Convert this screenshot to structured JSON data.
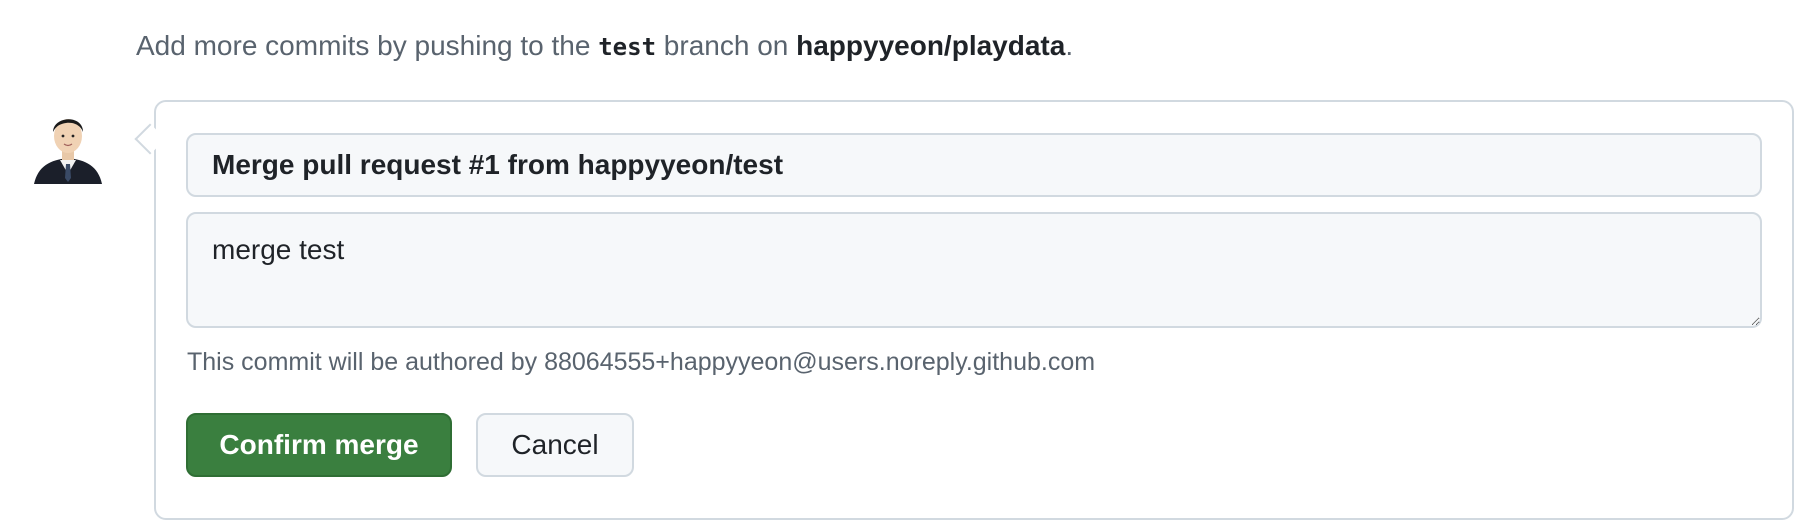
{
  "hint": {
    "prefix": "Add more commits by pushing to the ",
    "branch": "test",
    "middle": " branch on ",
    "repo": "happyyeon/playdata",
    "suffix": "."
  },
  "merge_form": {
    "commit_title": "Merge pull request #1 from happyyeon/test",
    "commit_body": "merge test",
    "author_note": "This commit will be authored by 88064555+happyyeon@users.noreply.github.com",
    "confirm_label": "Confirm merge",
    "cancel_label": "Cancel"
  },
  "colors": {
    "confirm_bg": "#3a7f3f",
    "border": "#d1d9e0",
    "muted_text": "#59636e"
  },
  "icons": {
    "avatar": "user-avatar-photo"
  }
}
